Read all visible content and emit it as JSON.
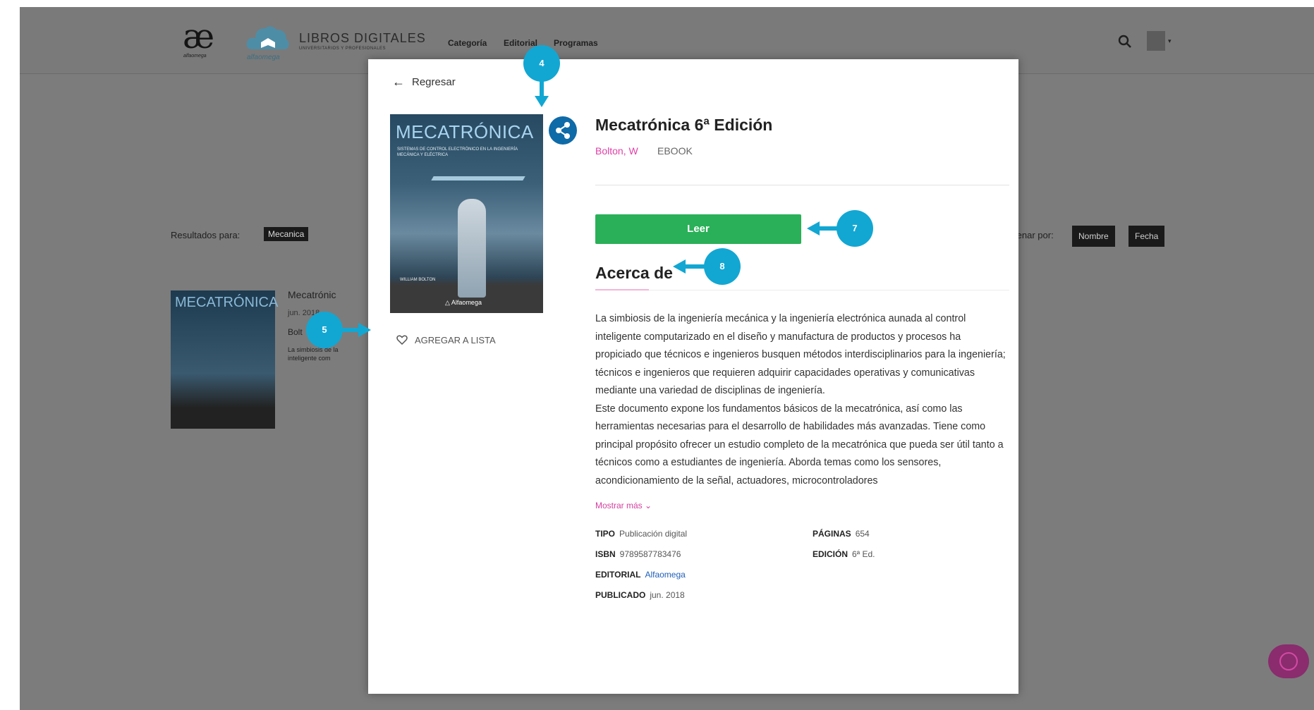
{
  "header": {
    "logo_ae_text": "æ",
    "logo_ae_sub": "alfaomega",
    "logo_cloud_sub": "alfaomega",
    "brand_title": "LIBROS DIGITALES",
    "brand_sub": "UNIVERSITARIOS Y PROFESIONALES",
    "nav": [
      "Categoría",
      "Editorial",
      "Programas"
    ],
    "avatar_caret": "▾"
  },
  "results": {
    "label": "Resultados para:",
    "tag": "Mecanica",
    "sort_label": "Ordenar por:",
    "sort_options": [
      "Nombre",
      "Fecha"
    ]
  },
  "background_item": {
    "cover_title": "MECATRÓNICA",
    "title": "Mecatrónic",
    "meta": "jun. 2018",
    "author": "Bolt",
    "desc": "La simbiosis de la inteligente com"
  },
  "modal": {
    "back_arrow": "←",
    "back_label": "Regresar",
    "cover": {
      "title": "MECATRÓNICA",
      "subtitle": "SISTEMAS DE CONTROL ELECTRÓNICO EN LA INGENIERÍA MECÁNICA Y ELÉCTRICA",
      "author": "WILLIAM BOLTON",
      "publisher": "△ Alfaomega"
    },
    "add_to_list": "AGREGAR A LISTA",
    "title": "Mecatrónica 6ª Edición",
    "author": "Bolton, W",
    "format": "EBOOK",
    "read_button": "Leer",
    "about_title": "Acerca de",
    "description": [
      "La simbiosis de la ingeniería mecánica y la ingeniería electrónica aunada al control inteligente computarizado en el diseño y manufactura de productos y procesos ha propiciado que técnicos e ingenieros busquen métodos interdisciplinarios para la ingeniería; técnicos e ingenieros que requieren adquirir capacidades operativas y comunicativas mediante una variedad de disciplinas de ingeniería.",
      "Este documento expone los fundamentos básicos de la mecatrónica, así como las herramientas necesarias para el desarrollo de habilidades más avanzadas. Tiene como principal propósito ofrecer un estudio completo de la mecatrónica que pueda ser útil tanto a técnicos como a estudiantes de ingeniería. Aborda temas como los sensores, acondicionamiento de la señal, actuadores, microcontroladores"
    ],
    "show_more": "Mostrar más ⌄",
    "details": {
      "tipo_label": "TIPO",
      "tipo_value": "Publicación digital",
      "isbn_label": "ISBN",
      "isbn_value": "9789587783476",
      "editorial_label": "EDITORIAL",
      "editorial_value": "Alfaomega",
      "publicado_label": "PUBLICADO",
      "publicado_value": "jun. 2018",
      "paginas_label": "PÁGINAS",
      "paginas_value": "654",
      "edicion_label": "EDICIÓN",
      "edicion_value": "6ª Ed."
    }
  },
  "callouts": {
    "share": "4",
    "add_list": "5",
    "read": "7",
    "about": "8"
  },
  "colors": {
    "callout": "#12a7d3",
    "read_button": "#2ab058",
    "author_link": "#e13fa6",
    "share_button": "#0f6aa8"
  }
}
